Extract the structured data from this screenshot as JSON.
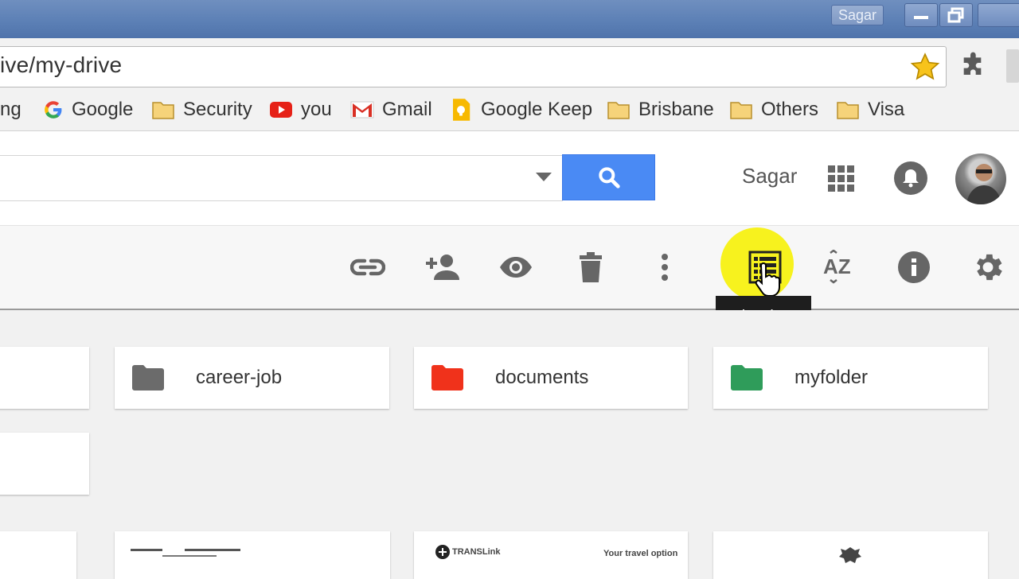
{
  "window": {
    "user_chip": "Sagar"
  },
  "address_bar": {
    "url": "ive/my-drive"
  },
  "bookmarks": [
    {
      "label": "ng",
      "icon": "none"
    },
    {
      "label": "Google",
      "icon": "google-g-icon"
    },
    {
      "label": "Security",
      "icon": "folder-icon"
    },
    {
      "label": "you",
      "icon": "youtube-icon"
    },
    {
      "label": "Gmail",
      "icon": "gmail-icon"
    },
    {
      "label": "Google Keep",
      "icon": "keep-icon"
    },
    {
      "label": "Brisbane",
      "icon": "folder-icon"
    },
    {
      "label": "Others",
      "icon": "folder-icon"
    },
    {
      "label": "Visa",
      "icon": "folder-icon"
    }
  ],
  "header": {
    "user_name": "Sagar"
  },
  "toolbar": {
    "tooltip": "List view"
  },
  "folders": [
    {
      "name": "career-job",
      "color": "#6b6b6b"
    },
    {
      "name": "documents",
      "color": "#f0321b"
    },
    {
      "name": "myfolder",
      "color": "#2f9c5a"
    }
  ],
  "file_thumbs": [
    {
      "text_left": "",
      "text_right": ""
    },
    {
      "text_left": "TRANSLink",
      "text_right": "Your travel option"
    },
    {
      "text_left": "",
      "text_right": ""
    }
  ],
  "colors": {
    "search_button": "#4a8af4",
    "highlight": "#f7f21e"
  }
}
